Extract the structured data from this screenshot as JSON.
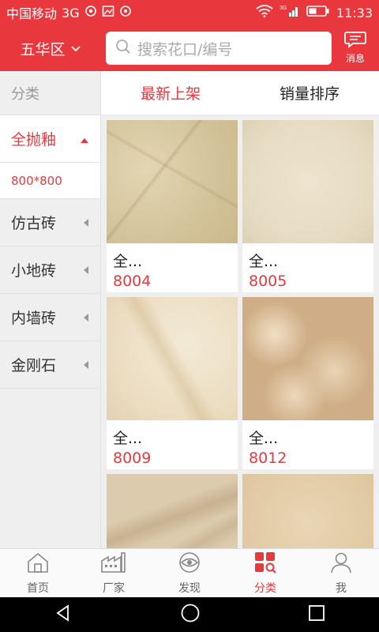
{
  "status_bar": {
    "carrier": "中国移动",
    "network": "3G",
    "time": "11:33",
    "network_small": "3G"
  },
  "header": {
    "district": "五华区",
    "search_placeholder": "搜索花口/编号",
    "message_label": "消息"
  },
  "sidebar": {
    "header": "分类",
    "items": [
      {
        "label": "全抛釉",
        "active": true
      },
      {
        "label": "仿古砖"
      },
      {
        "label": "小地砖"
      },
      {
        "label": "内墙砖"
      },
      {
        "label": "金刚石"
      }
    ],
    "sub_item": "800*800"
  },
  "sort_tabs": [
    {
      "label": "最新上架",
      "active": true
    },
    {
      "label": "销量排序"
    }
  ],
  "products": [
    {
      "name": "全...",
      "code": "8004"
    },
    {
      "name": "全...",
      "code": "8005"
    },
    {
      "name": "全...",
      "code": "8009"
    },
    {
      "name": "全...",
      "code": "8012"
    }
  ],
  "bottom_nav": [
    {
      "label": "首页",
      "icon": "home-icon"
    },
    {
      "label": "厂家",
      "icon": "factory-icon"
    },
    {
      "label": "发现",
      "icon": "eye-icon"
    },
    {
      "label": "分类",
      "icon": "category-icon",
      "active": true
    },
    {
      "label": "我",
      "icon": "user-icon"
    }
  ],
  "colors": {
    "accent": "#e8383d",
    "sidebar_bg": "#efefef",
    "text": "#333333"
  }
}
